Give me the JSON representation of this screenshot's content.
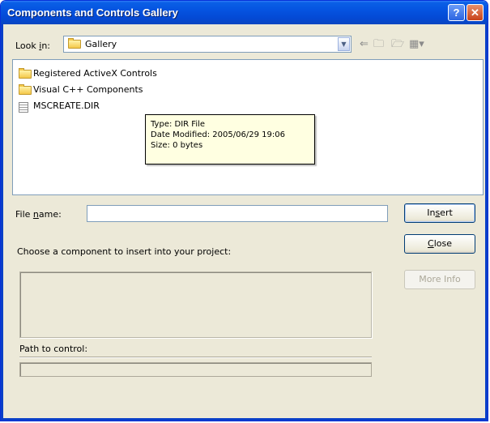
{
  "window": {
    "title": "Components and Controls Gallery",
    "help_glyph": "?",
    "close_glyph": "✕"
  },
  "toolbar": {
    "look_in_label_pre": "Look ",
    "look_in_label_accel": "i",
    "look_in_label_post": "n:",
    "look_in_value": "Gallery",
    "combo_arrow": "▼",
    "back_glyph": "⇐",
    "up_folder_glyph": "🗀",
    "new_folder_glyph": "🗁",
    "views_glyph": "▦▾"
  },
  "file_list": {
    "items": [
      {
        "label": "Registered ActiveX Controls",
        "icon": "folder-icon"
      },
      {
        "label": "Visual C++ Components",
        "icon": "folder-icon"
      },
      {
        "label": "MSCREATE.DIR",
        "icon": "document-icon"
      }
    ]
  },
  "tooltip": {
    "type_line": "Type: DIR File",
    "modified_line": "Date Modified: 2005/06/29 19:06",
    "size_line": "Size: 0 bytes"
  },
  "file_name": {
    "label_pre": "File ",
    "label_accel": "n",
    "label_post": "ame:",
    "value": ""
  },
  "buttons": {
    "insert_pre": "In",
    "insert_accel": "s",
    "insert_post": "ert",
    "close_accel": "C",
    "close_post": "lose",
    "more_info": "More Info"
  },
  "prompt_text": "Choose a component to insert into your project:",
  "path_label": "Path to control:"
}
